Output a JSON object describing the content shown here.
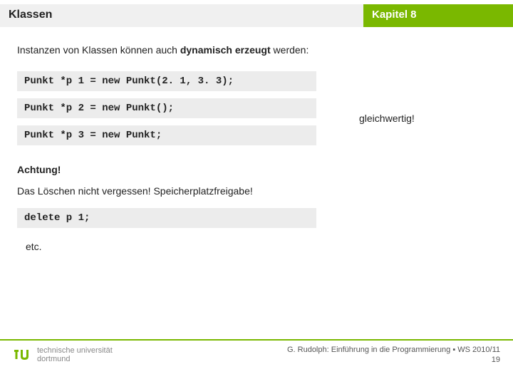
{
  "header": {
    "left_title": "Klassen",
    "right_title": "Kapitel 8"
  },
  "intro": {
    "prefix": "Instanzen von Klassen können auch ",
    "bold": "dynamisch erzeugt",
    "suffix": " werden:"
  },
  "code": {
    "line1": "Punkt *p 1 = new Punkt(2. 1, 3. 3);",
    "line2": "Punkt *p 2 = new Punkt();",
    "line3": "Punkt *p 3 = new Punkt;",
    "delete_line": "delete p 1;"
  },
  "side_note": "gleichwertig!",
  "achtung": "Achtung!",
  "warning": "Das Löschen nicht vergessen! Speicherplatzfreigabe!",
  "etc": "etc.",
  "footer": {
    "uni_line1": "technische universität",
    "uni_line2": "dortmund",
    "credit_line": "G. Rudolph: Einführung in die Programmierung ▪ WS 2010/11",
    "page_number": "19"
  }
}
